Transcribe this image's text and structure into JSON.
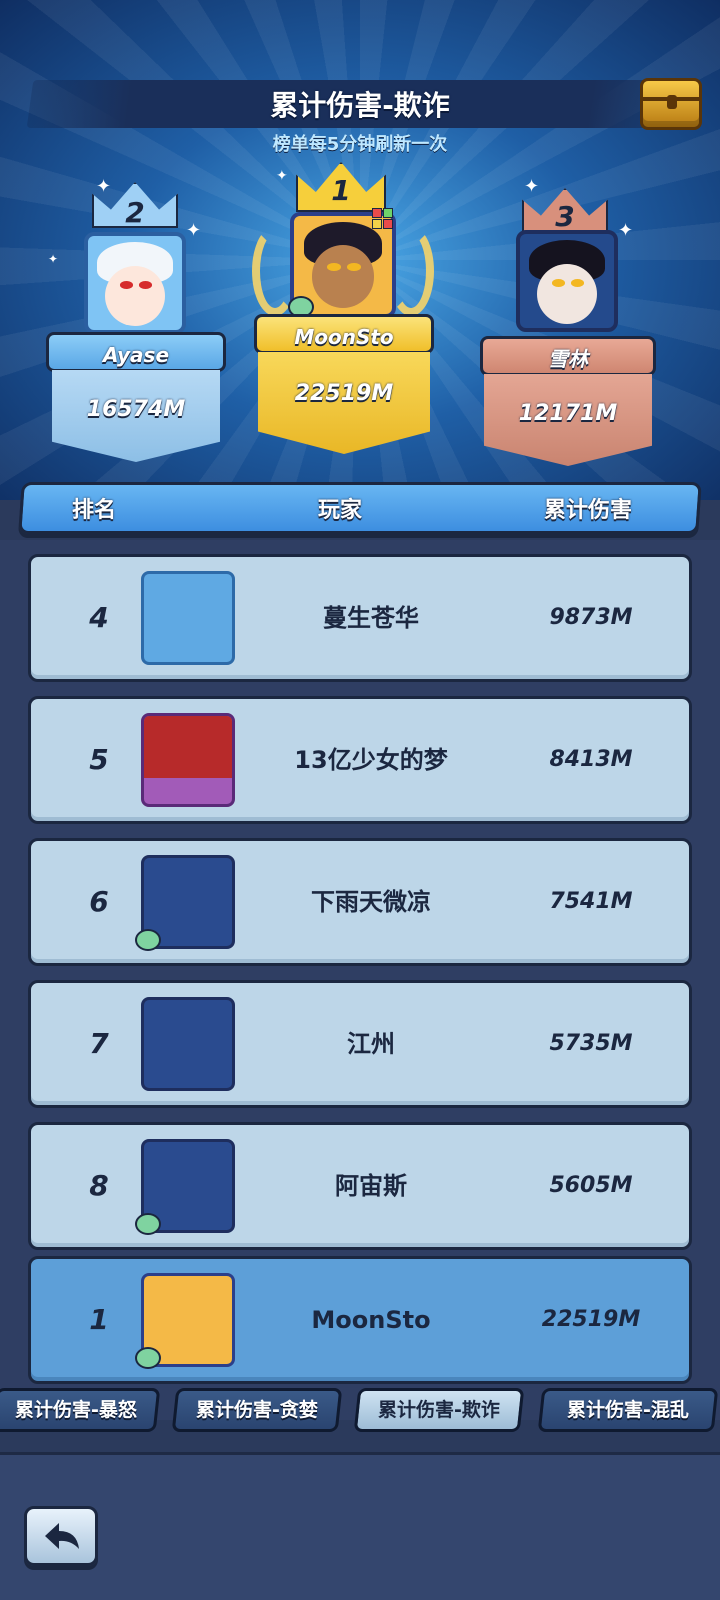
{
  "header": {
    "title": "累计伤害-欺诈",
    "subtitle": "榜单每5分钟刷新一次",
    "chest_icon": "treasure-chest-icon"
  },
  "podium": [
    {
      "rank": "2",
      "name": "Ayase",
      "damage": "16574M",
      "color": "#6fb6ef"
    },
    {
      "rank": "1",
      "name": "MoonSto",
      "damage": "22519M",
      "color": "#f6cf3b"
    },
    {
      "rank": "3",
      "name": "雪林",
      "damage": "12171M",
      "color": "#d8907c"
    }
  ],
  "table": {
    "headers": {
      "rank": "排名",
      "player": "玩家",
      "damage": "累计伤害"
    },
    "rows": [
      {
        "rank": "4",
        "name": "蔓生苍华",
        "damage": "9873M"
      },
      {
        "rank": "5",
        "name": "13亿少女的梦",
        "damage": "8413M"
      },
      {
        "rank": "6",
        "name": "下雨天微凉",
        "damage": "7541M"
      },
      {
        "rank": "7",
        "name": "江州",
        "damage": "5735M"
      },
      {
        "rank": "8",
        "name": "阿宙斯",
        "damage": "5605M"
      }
    ],
    "self_row": {
      "rank": "1",
      "name": "MoonSto",
      "damage": "22519M"
    }
  },
  "tabs": [
    {
      "label": "累计伤害-暴怒",
      "active": false
    },
    {
      "label": "累计伤害-贪婪",
      "active": false
    },
    {
      "label": "累计伤害-欺诈",
      "active": true
    },
    {
      "label": "累计伤害-混乱",
      "active": false
    }
  ],
  "nav": {
    "back_icon": "back-arrow-icon"
  }
}
